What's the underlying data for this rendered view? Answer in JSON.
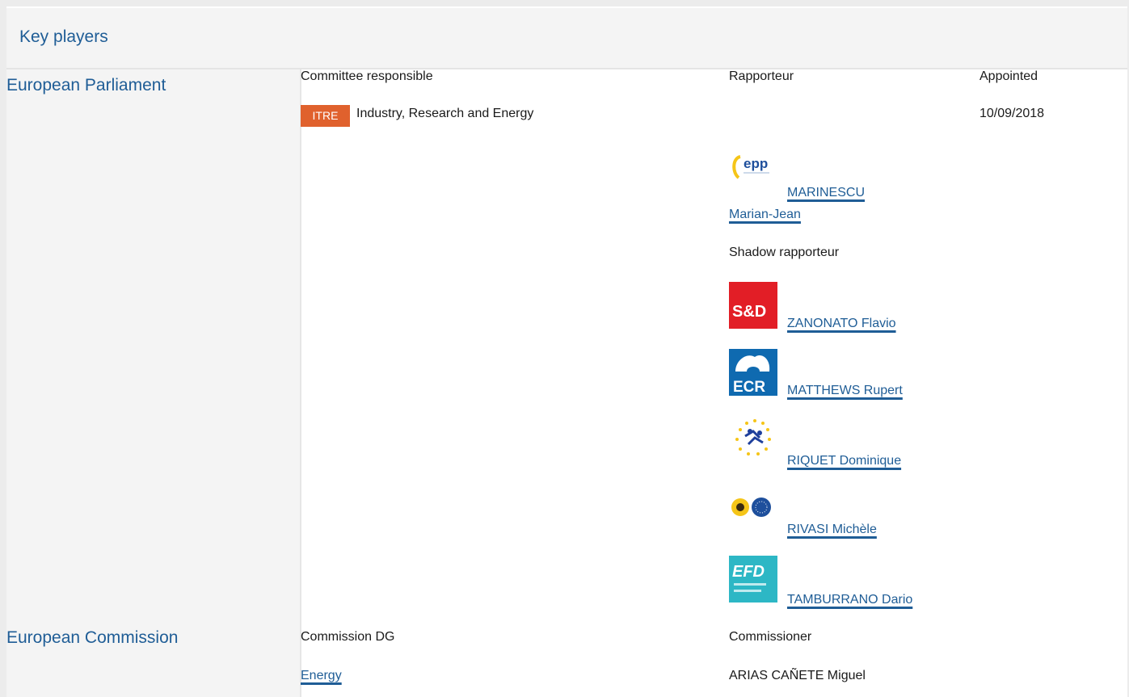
{
  "header": {
    "title": "Key players"
  },
  "parliament": {
    "institution": "European Parliament",
    "committee_col": "Committee responsible",
    "rapporteur_col": "Rapporteur",
    "appointed_col": "Appointed",
    "committee_badge": "ITRE",
    "committee_name": "Industry, Research and Energy",
    "appointed_date": "10/09/2018",
    "rapporteur": {
      "name_line1": "MARINESCU",
      "name_line2": "Marian-Jean",
      "group_logo_text": "epp",
      "group_icon": "epp-logo"
    },
    "shadow_label": "Shadow rapporteur",
    "shadows": [
      {
        "name": "ZANONATO Flavio",
        "group_logo_text": "S&D",
        "group_icon": "s-and-d-logo",
        "color": "#e21e26"
      },
      {
        "name": "MATTHEWS Rupert",
        "group_logo_text": "ECR",
        "group_icon": "ecr-logo",
        "color": "#0f6ab0"
      },
      {
        "name": "RIQUET Dominique",
        "group_icon": "renew-stars-logo"
      },
      {
        "name": "RIVASI Michèle",
        "group_icon": "greens-efa-logo"
      },
      {
        "name": "TAMBURRANO Dario",
        "group_logo_text": "EFD",
        "group_icon": "efdd-logo",
        "color": "#2db7c5"
      }
    ]
  },
  "commission": {
    "institution": "European Commission",
    "dg_col": "Commission DG",
    "commissioner_col": "Commissioner",
    "dg": "Energy",
    "commissioner": "ARIAS CAÑETE Miguel"
  },
  "colors": {
    "link": "#1f5d96",
    "badge": "#e0612d",
    "panel": "#f4f4f4"
  }
}
